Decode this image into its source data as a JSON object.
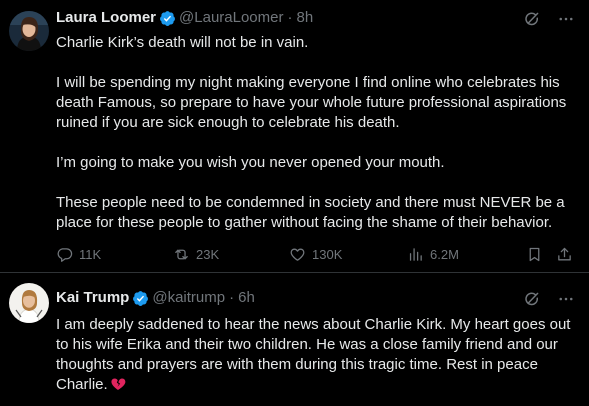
{
  "tweets": [
    {
      "author": {
        "name": "Laura Loomer",
        "handle": "@LauraLoomer",
        "time": "8h",
        "verified": true
      },
      "paragraphs": [
        "Charlie Kirk’s death will not be in vain.",
        "I will be spending my night making everyone I find online who celebrates his death Famous, so prepare to have your whole future professional aspirations ruined if you are sick enough to celebrate his death.",
        "I’m going to make you wish you never opened your mouth.",
        "These people need to be condemned in society and there must NEVER be a place for these people to gather without facing the shame of their behavior."
      ],
      "stats": {
        "replies": "11K",
        "reposts": "23K",
        "likes": "130K",
        "views": "6.2M"
      }
    },
    {
      "author": {
        "name": "Kai Trump",
        "handle": "@kaitrump",
        "time": "6h",
        "verified": true
      },
      "paragraphs": [
        "I am deeply saddened to hear the news about Charlie Kirk. My heart goes out to his wife Erika and their two children. He was a close family friend and our thoughts and prayers are with them during this tragic time. Rest in peace Charlie."
      ],
      "emoji": "broken-heart-emoji"
    }
  ],
  "icons": {
    "verified_color": "#1d9bf0",
    "muted_color": "#71767b"
  }
}
